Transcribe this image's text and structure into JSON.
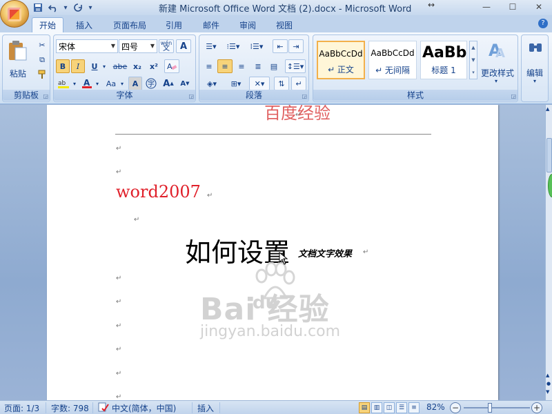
{
  "window": {
    "title": "新建 Microsoft Office Word 文档 (2).docx - Microsoft Word",
    "controls": [
      "—",
      "☐",
      "✕"
    ]
  },
  "qat": {
    "save_icon": "save-icon",
    "undo_icon": "undo-icon",
    "redo_icon": "redo-icon"
  },
  "tabs": [
    "开始",
    "插入",
    "页面布局",
    "引用",
    "邮件",
    "审阅",
    "视图"
  ],
  "active_tab": "开始",
  "ribbon": {
    "clipboard": {
      "label": "剪贴板",
      "paste": "粘贴"
    },
    "font": {
      "label": "字体",
      "font_name": "宋体",
      "font_size": "四号",
      "wen_label": "wén",
      "bold": "B",
      "italic": "I",
      "underline": "U",
      "strike": "abe",
      "subscript": "x₂",
      "superscript": "x²",
      "case": "Aa",
      "char_border": "A",
      "grow": "A",
      "shrink": "A"
    },
    "paragraph": {
      "label": "段落"
    },
    "styles": {
      "label": "样式",
      "items": [
        {
          "sample": "AaBbCcDd",
          "name": "↵ 正文"
        },
        {
          "sample": "AaBbCcDd",
          "name": "↵ 无间隔"
        },
        {
          "sample": "AaBb",
          "name": "标题 1"
        }
      ],
      "change_styles": "更改样式"
    },
    "editing": {
      "label": "编辑"
    }
  },
  "document": {
    "header_text": "百度经验",
    "heading": "word2007",
    "big_title": "如何设置",
    "small_title": "文档文字效果",
    "watermark_logo": "Bai 经验",
    "watermark_du": "du",
    "watermark_url": "jingyan.baidu.com",
    "para_mark": "↵"
  },
  "status": {
    "page": "页面: 1/3",
    "words": "字数: 798",
    "language": "中文(简体，中国)",
    "mode": "插入",
    "zoom": "82%"
  },
  "colors": {
    "accent": "#15428b",
    "ribbon_bg": "#dce8f6",
    "heading_red": "#e0202a"
  }
}
